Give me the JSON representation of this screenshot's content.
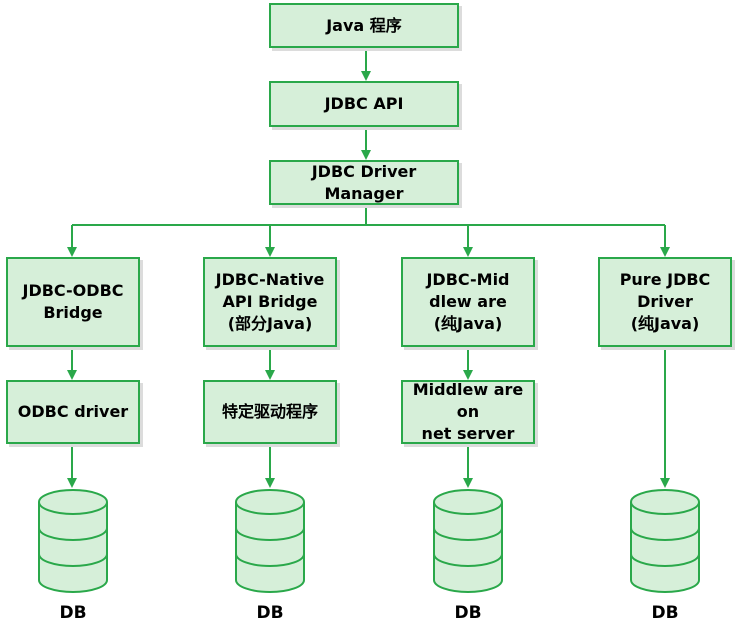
{
  "colors": {
    "box_fill": "#d6efd9",
    "box_border": "#2aa84a",
    "line": "#2aa84a"
  },
  "top": {
    "java_program": "Java 程序",
    "jdbc_api": "JDBC API",
    "driver_manager": "JDBC Driver Manager"
  },
  "columns": [
    {
      "driver": "JDBC-ODBC\nBridge",
      "layer": "ODBC driver",
      "db": "DB"
    },
    {
      "driver": "JDBC-Native\nAPI Bridge\n(部分Java)",
      "layer": "特定驱动程序",
      "db": "DB"
    },
    {
      "driver": "JDBC-Mid\ndlew are\n(纯Java)",
      "layer": "Middlew are on\nnet server",
      "db": "DB"
    },
    {
      "driver": "Pure JDBC\nDriver\n(纯Java)",
      "layer": null,
      "db": "DB"
    }
  ]
}
